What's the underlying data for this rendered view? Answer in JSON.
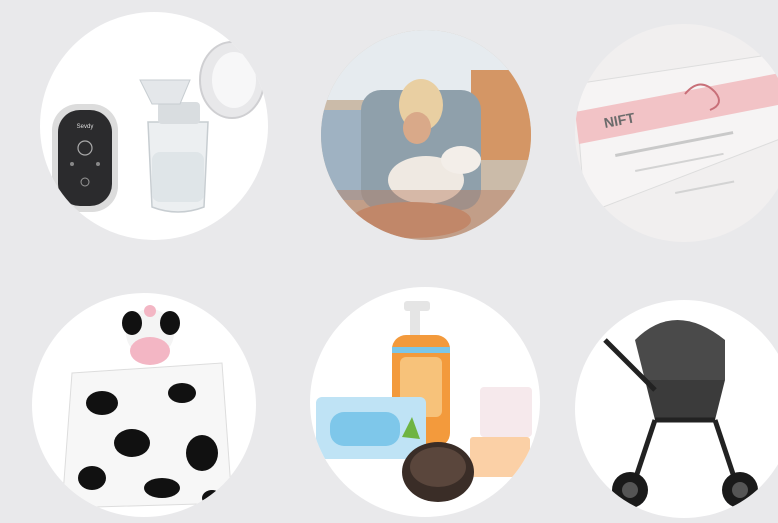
{
  "products": [
    {
      "name": "breast-pump",
      "brand_text": "Sevdy",
      "bg": "#ffffff"
    },
    {
      "name": "mother-with-baby-photo",
      "bg": "#c9b9a8"
    },
    {
      "name": "nift-box",
      "brand_text": "NIFT",
      "bg": "#f1efef"
    },
    {
      "name": "cow-blanket-toy",
      "bg": "#ffffff"
    },
    {
      "name": "baby-care-set",
      "bg": "#ffffff"
    },
    {
      "name": "baby-stroller",
      "bg": "#ffffff"
    }
  ],
  "colors": {
    "page_bg": "#e9e9eb",
    "accent_pink": "#f2c3c6",
    "orange": "#f39a3c"
  }
}
